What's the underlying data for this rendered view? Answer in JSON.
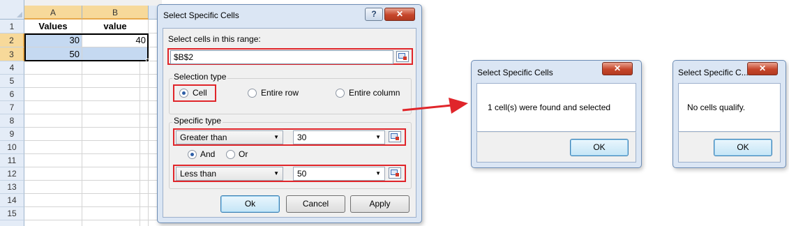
{
  "sheet": {
    "columns": [
      "A",
      "B"
    ],
    "rows": [
      "1",
      "2",
      "3",
      "4",
      "5",
      "6",
      "7",
      "8",
      "9",
      "10",
      "11",
      "12",
      "13",
      "14",
      "15"
    ],
    "cells": {
      "a1": "Values",
      "b1": "value",
      "a2": "30",
      "b2": "40",
      "a3": "50",
      "b3": ""
    }
  },
  "main_dialog": {
    "title": "Select Specific Cells",
    "help_glyph": "?",
    "close_glyph": "✕",
    "range_label": "Select cells in this range:",
    "range_value": "$B$2",
    "selection_type": {
      "legend": "Selection type",
      "options": [
        "Cell",
        "Entire row",
        "Entire column"
      ],
      "selected": "Cell"
    },
    "specific_type": {
      "legend": "Specific type",
      "first": {
        "operator": "Greater than",
        "value": "30"
      },
      "logic_options": [
        "And",
        "Or"
      ],
      "logic_selected": "And",
      "second": {
        "operator": "Less than",
        "value": "50"
      }
    },
    "buttons": {
      "ok": "Ok",
      "cancel": "Cancel",
      "apply": "Apply"
    }
  },
  "result_dialog_1": {
    "title": "Select Specific Cells",
    "message": "1 cell(s) were found and selected",
    "ok": "OK"
  },
  "result_dialog_2": {
    "title": "Select Specific C...",
    "message": "No cells qualify.",
    "ok": "OK"
  },
  "colors": {
    "highlight_box": "#e0252a",
    "arrow": "#e0252a",
    "selected_cell_fill": "#c5d9f1",
    "header_selected": "#f7d99a",
    "dialog_frame": "#dbe6f4"
  }
}
